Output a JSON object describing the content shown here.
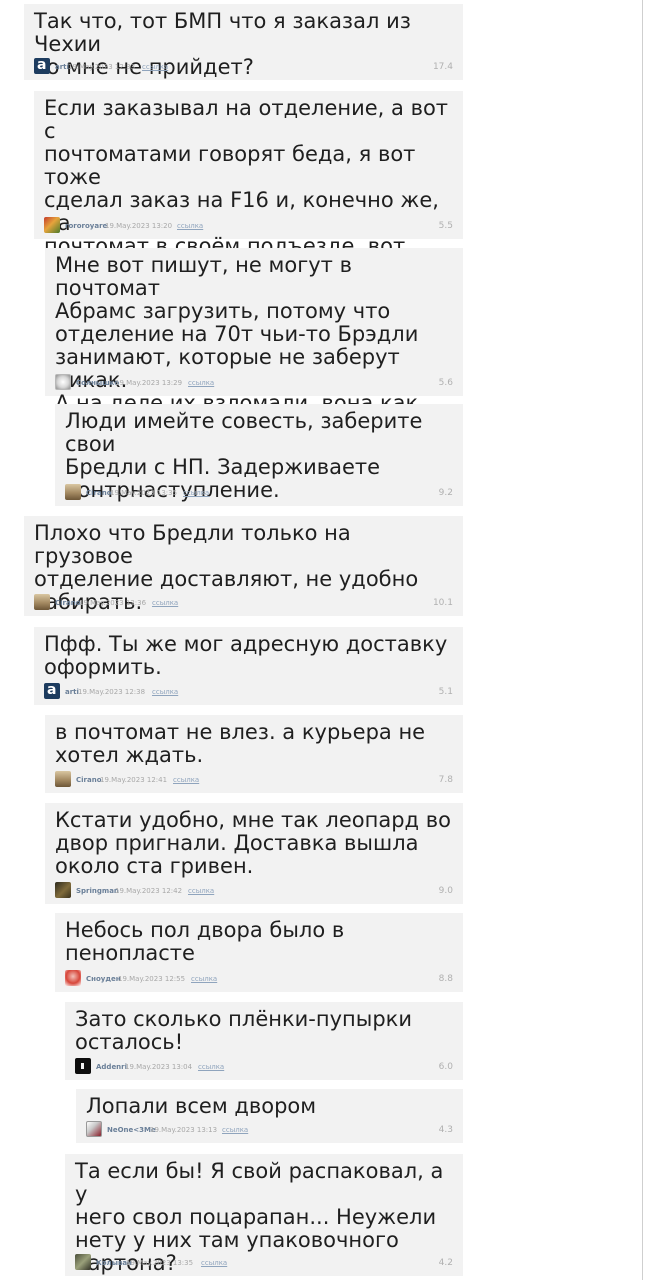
{
  "comments": [
    {
      "text": "Так что, тот БМП что я заказал из Чехии\nко мне не прийдет?",
      "author": "arti",
      "date": "19.May.2023 12:33",
      "link": "ссылка",
      "rating": "17.4",
      "avatar": "a-logo-avatar"
    },
    {
      "text": "Если заказывал на отделение, а вот с\nпочтоматами говорят беда, я вот тоже\nсделал заказ на F16 и, конечно же, на\nпочтомат в своём подъезде, вот сижу\nпереживаю",
      "author": "rororoyare",
      "date": "19.May.2023 13:20",
      "link": "ссылка",
      "rating": "5.5",
      "avatar": "colorful-avatar"
    },
    {
      "text": "Мне вот пишут, не могут в почтомат\nАбрамс загрузить, потому что\nотделение на 70т чьи-то Брэдли\nзанимают, которые не заберут никак.\nА на деле их взломали, вона как.",
      "author": "Солнышко",
      "date": "19.May.2023 13:29",
      "link": "ссылка",
      "rating": "5.6",
      "avatar": "sun-avatar"
    },
    {
      "text": "Люди имейте совесть, заберите свои\nБредли с НП. Задерживаете\nконтрнаступление.",
      "author": "Cirano",
      "date": "19.May.2023 13:35",
      "link": "ссылка",
      "rating": "9.2",
      "avatar": "cirano-avatar"
    },
    {
      "text": "Плохо что Бредли только на грузовое\nотделение доставляют, не удобно\nзабирать.",
      "author": "Cirano",
      "date": "19.May.2023 12:36",
      "link": "ссылка",
      "rating": "10.1",
      "avatar": "cirano-avatar"
    },
    {
      "text": "Пфф. Ты же мог адресную доставку\nоформить.",
      "author": "arti",
      "date": "19.May.2023 12:38",
      "link": "ссылка",
      "rating": "5.1",
      "avatar": "a-logo-avatar"
    },
    {
      "text": "в почтомат не влез. а курьера не\nхотел ждать.",
      "author": "Cirano",
      "date": "19.May.2023 12:41",
      "link": "ссылка",
      "rating": "7.8",
      "avatar": "cirano-avatar"
    },
    {
      "text": "Кстати удобно, мне так леопард во\nдвор пригнали. Доставка вышла\nоколо ста гривен.",
      "author": "Springman",
      "date": "19.May.2023 12:42",
      "link": "ссылка",
      "rating": "9.0",
      "avatar": "springman-avatar"
    },
    {
      "text": "Небось пол двора было в\nпенопласте",
      "author": "Сноуден",
      "date": "19.May.2023 12:55",
      "link": "ссылка",
      "rating": "8.8",
      "avatar": "snowden-avatar"
    },
    {
      "text": "Зато сколько плёнки-пупырки\nосталось!",
      "author": "Addenri",
      "date": "19.May.2023 13:04",
      "link": "ссылка",
      "rating": "6.0",
      "avatar": "addenri-avatar"
    },
    {
      "text": "Лопали всем двором",
      "author": "NeOne<3Me",
      "date": "19.May.2023 13:13",
      "link": "ссылка",
      "rating": "4.3",
      "avatar": "neone-avatar"
    },
    {
      "text": "Та если бы! Я свой распаковал, а у\nнего свол поцарапан... Неужели\nнету у них там упаковочного\nкартона?",
      "author": "Колыван",
      "date": "19.May.2023 13:35",
      "link": "ссылка",
      "rating": "4.2",
      "avatar": "kolyvan-avatar"
    }
  ]
}
